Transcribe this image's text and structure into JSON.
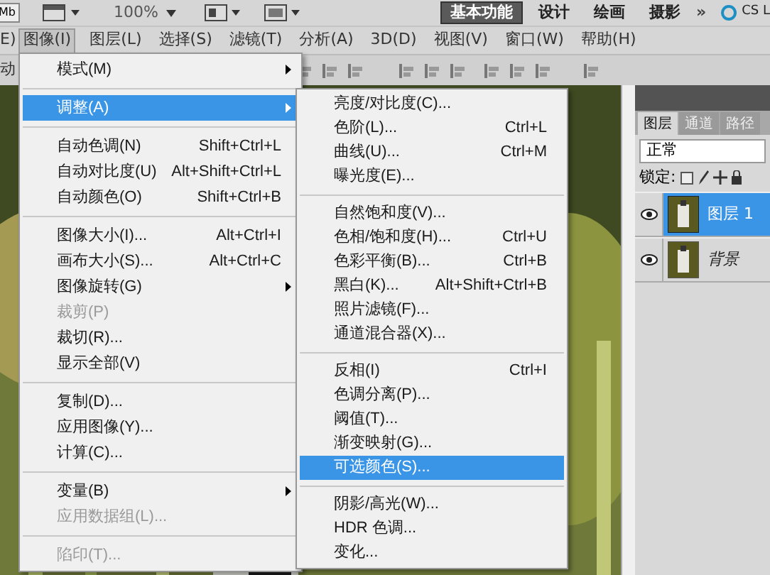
{
  "app_bar": {
    "size_badge": "Mb",
    "zoom": "100%",
    "workspaces": [
      {
        "label": "基本功能",
        "selected": true
      },
      {
        "label": "设计",
        "selected": false
      },
      {
        "label": "绘画",
        "selected": false
      },
      {
        "label": "摄影",
        "selected": false
      }
    ],
    "more": "»",
    "cs_live": "CS L"
  },
  "menu_bar": {
    "cut_item": "E)",
    "items": [
      {
        "label": "图像(I)",
        "selected": true
      },
      {
        "label": "图层(L)",
        "selected": false
      },
      {
        "label": "选择(S)",
        "selected": false
      },
      {
        "label": "滤镜(T)",
        "selected": false
      },
      {
        "label": "分析(A)",
        "selected": false
      },
      {
        "label": "3D(D)",
        "selected": false
      },
      {
        "label": "视图(V)",
        "selected": false
      },
      {
        "label": "窗口(W)",
        "selected": false
      },
      {
        "label": "帮助(H)",
        "selected": false
      }
    ]
  },
  "options_bar": {
    "cut_label": "动"
  },
  "image_menu": [
    {
      "kind": "item",
      "label": "模式(M)",
      "submenu": true,
      "selected": false,
      "disabled": false
    },
    {
      "kind": "separator"
    },
    {
      "kind": "item",
      "label": "调整(A)",
      "submenu": true,
      "selected": true,
      "disabled": false
    },
    {
      "kind": "separator"
    },
    {
      "kind": "item",
      "label": "自动色调(N)",
      "shortcut": "Shift+Ctrl+L",
      "selected": false,
      "disabled": false
    },
    {
      "kind": "item",
      "label": "自动对比度(U)",
      "shortcut": "Alt+Shift+Ctrl+L",
      "selected": false,
      "disabled": false
    },
    {
      "kind": "item",
      "label": "自动颜色(O)",
      "shortcut": "Shift+Ctrl+B",
      "selected": false,
      "disabled": false
    },
    {
      "kind": "separator"
    },
    {
      "kind": "item",
      "label": "图像大小(I)...",
      "shortcut": "Alt+Ctrl+I",
      "selected": false,
      "disabled": false
    },
    {
      "kind": "item",
      "label": "画布大小(S)...",
      "shortcut": "Alt+Ctrl+C",
      "selected": false,
      "disabled": false
    },
    {
      "kind": "item",
      "label": "图像旋转(G)",
      "submenu": true,
      "selected": false,
      "disabled": false
    },
    {
      "kind": "item",
      "label": "裁剪(P)",
      "selected": false,
      "disabled": true
    },
    {
      "kind": "item",
      "label": "裁切(R)...",
      "selected": false,
      "disabled": false
    },
    {
      "kind": "item",
      "label": "显示全部(V)",
      "selected": false,
      "disabled": false
    },
    {
      "kind": "separator"
    },
    {
      "kind": "item",
      "label": "复制(D)...",
      "selected": false,
      "disabled": false
    },
    {
      "kind": "item",
      "label": "应用图像(Y)...",
      "selected": false,
      "disabled": false
    },
    {
      "kind": "item",
      "label": "计算(C)...",
      "selected": false,
      "disabled": false
    },
    {
      "kind": "separator"
    },
    {
      "kind": "item",
      "label": "变量(B)",
      "submenu": true,
      "selected": false,
      "disabled": false
    },
    {
      "kind": "item",
      "label": "应用数据组(L)...",
      "selected": false,
      "disabled": true
    },
    {
      "kind": "separator"
    },
    {
      "kind": "item",
      "label": "陷印(T)...",
      "selected": false,
      "disabled": true
    }
  ],
  "adjust_submenu": [
    {
      "kind": "item",
      "label": "亮度/对比度(C)...",
      "selected": false
    },
    {
      "kind": "item",
      "label": "色阶(L)...",
      "shortcut": "Ctrl+L",
      "selected": false
    },
    {
      "kind": "item",
      "label": "曲线(U)...",
      "shortcut": "Ctrl+M",
      "selected": false
    },
    {
      "kind": "item",
      "label": "曝光度(E)...",
      "selected": false
    },
    {
      "kind": "separator"
    },
    {
      "kind": "item",
      "label": "自然饱和度(V)...",
      "selected": false
    },
    {
      "kind": "item",
      "label": "色相/饱和度(H)...",
      "shortcut": "Ctrl+U",
      "selected": false
    },
    {
      "kind": "item",
      "label": "色彩平衡(B)...",
      "shortcut": "Ctrl+B",
      "selected": false
    },
    {
      "kind": "item",
      "label": "黑白(K)...",
      "shortcut": "Alt+Shift+Ctrl+B",
      "selected": false
    },
    {
      "kind": "item",
      "label": "照片滤镜(F)...",
      "selected": false
    },
    {
      "kind": "item",
      "label": "通道混合器(X)...",
      "selected": false
    },
    {
      "kind": "separator"
    },
    {
      "kind": "item",
      "label": "反相(I)",
      "shortcut": "Ctrl+I",
      "selected": false
    },
    {
      "kind": "item",
      "label": "色调分离(P)...",
      "selected": false
    },
    {
      "kind": "item",
      "label": "阈值(T)...",
      "selected": false
    },
    {
      "kind": "item",
      "label": "渐变映射(G)...",
      "selected": false
    },
    {
      "kind": "item",
      "label": "可选颜色(S)...",
      "selected": true
    },
    {
      "kind": "separator"
    },
    {
      "kind": "item",
      "label": "阴影/高光(W)...",
      "selected": false
    },
    {
      "kind": "item",
      "label": "HDR 色调...",
      "selected": false
    },
    {
      "kind": "item",
      "label": "变化...",
      "selected": false
    }
  ],
  "layers_panel": {
    "tabs": [
      {
        "label": "图层",
        "selected": true
      },
      {
        "label": "通道",
        "selected": false
      },
      {
        "label": "路径",
        "selected": false
      }
    ],
    "blend_mode": "正常",
    "lock_label": "锁定:",
    "layers": [
      {
        "name": "图层 1",
        "kind": "layer",
        "selected": true,
        "visible": true
      },
      {
        "name": "背景",
        "kind": "background",
        "selected": false,
        "visible": true
      }
    ]
  }
}
